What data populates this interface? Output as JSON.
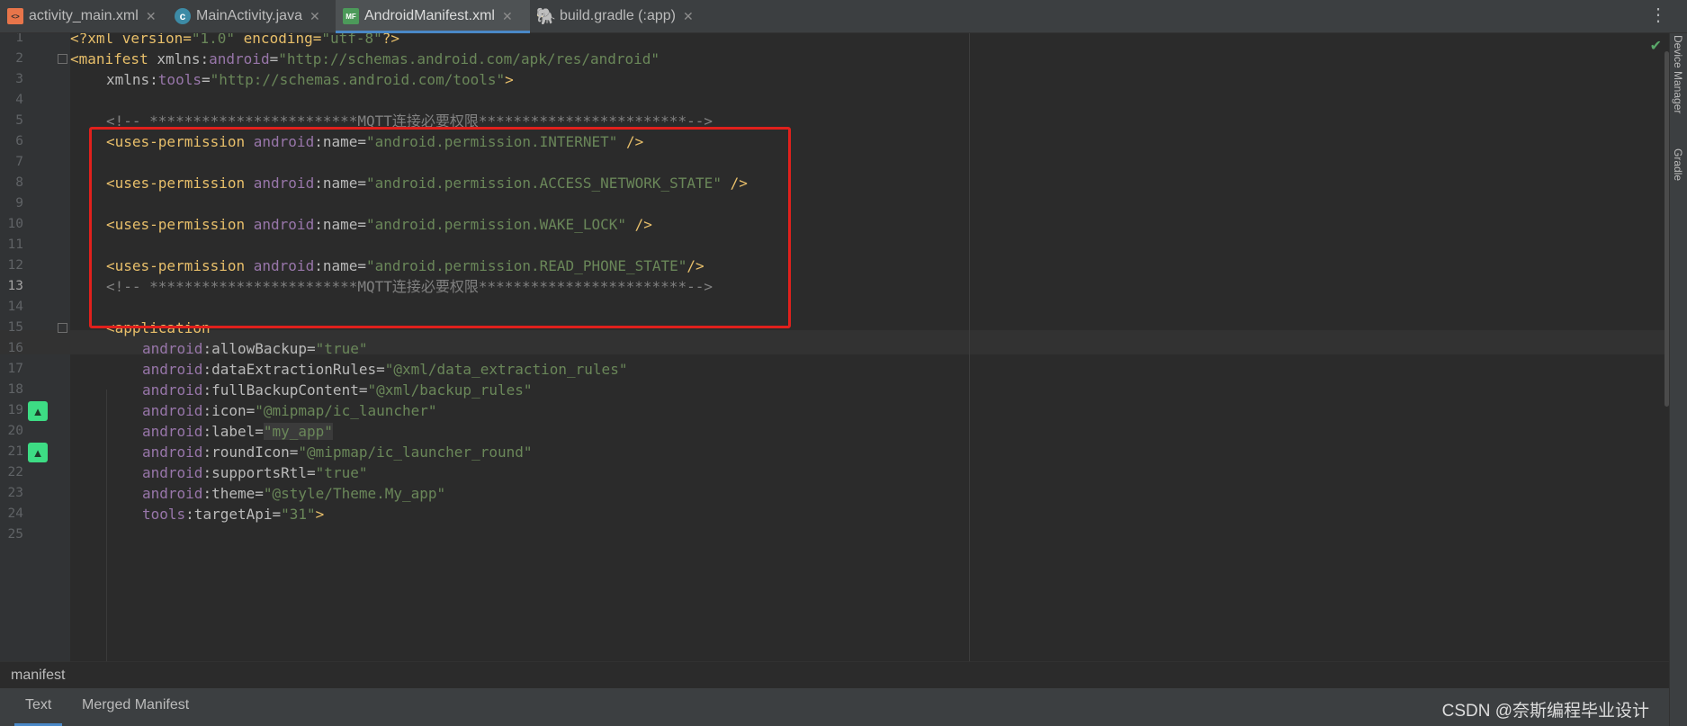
{
  "tabs": [
    {
      "label": "activity_main.xml",
      "icon": "xml-file-icon",
      "active": false
    },
    {
      "label": "MainActivity.java",
      "icon": "java-class-icon",
      "active": false
    },
    {
      "label": "AndroidManifest.xml",
      "icon": "manifest-file-icon",
      "active": true
    },
    {
      "label": "build.gradle (:app)",
      "icon": "gradle-icon",
      "active": false
    }
  ],
  "lines": {
    "l1": "1",
    "l2": "2",
    "l3": "3",
    "l4": "4",
    "l5": "5",
    "l6": "6",
    "l7": "7",
    "l8": "8",
    "l9": "9",
    "l10": "10",
    "l11": "11",
    "l12": "12",
    "l13": "13",
    "l14": "14",
    "l15": "15",
    "l16": "16",
    "l17": "17",
    "l18": "18",
    "l19": "19",
    "l20": "20",
    "l21": "21",
    "l22": "22",
    "l23": "23",
    "l24": "24",
    "l25": "25"
  },
  "code": {
    "l1": {
      "open": "<?xml version=",
      "ver": "\"1.0\"",
      "enc": " encoding=",
      "encv": "\"utf-8\"",
      "close": "?>"
    },
    "l2": {
      "tag": "<manifest",
      "attr": " xmlns:",
      "ns": "android",
      "eq": "=",
      "val": "\"http://schemas.android.com/apk/res/android\""
    },
    "l3": {
      "attr": "xmlns:",
      "ns": "tools",
      "eq": "=",
      "val": "\"http://schemas.android.com/tools\"",
      "close": ">"
    },
    "comment": "<!-- ************************MQTT连接必要权限************************-->",
    "perm_tag": "<uses-permission",
    "perm_ns": "android",
    "perm_attr": ":name=",
    "perm_close": " />",
    "perm_close_tight": "/>",
    "perms": [
      "\"android.permission.INTERNET\"",
      "\"android.permission.ACCESS_NETWORK_STATE\"",
      "\"android.permission.WAKE_LOCK\"",
      "\"android.permission.READ_PHONE_STATE\""
    ],
    "app_tag": "<application",
    "app_attrs": [
      {
        "ns": "android",
        "name": ":allowBackup=",
        "val": "\"true\""
      },
      {
        "ns": "android",
        "name": ":dataExtractionRules=",
        "val": "\"@xml/data_extraction_rules\""
      },
      {
        "ns": "android",
        "name": ":fullBackupContent=",
        "val": "\"@xml/backup_rules\""
      },
      {
        "ns": "android",
        "name": ":icon=",
        "val": "\"@mipmap/ic_launcher\""
      },
      {
        "ns": "android",
        "name": ":label=",
        "val": "\"my_app\""
      },
      {
        "ns": "android",
        "name": ":roundIcon=",
        "val": "\"@mipmap/ic_launcher_round\""
      },
      {
        "ns": "android",
        "name": ":supportsRtl=",
        "val": "\"true\""
      },
      {
        "ns": "android",
        "name": ":theme=",
        "val": "\"@style/Theme.My_app\""
      },
      {
        "ns": "tools",
        "name": ":targetApi=",
        "val": "\"31\"",
        "close": ">"
      }
    ]
  },
  "right_toolwindows": [
    "Device Manager",
    "Gradle"
  ],
  "breadcrumb": "manifest",
  "bottom_tabs": [
    "Text",
    "Merged Manifest"
  ],
  "watermark": "CSDN @奈斯编程毕业设计",
  "colors": {
    "highlight_box": "#e0201c",
    "tag": "#e8bf6a",
    "string": "#6a8759",
    "namespace": "#9876aa",
    "comment": "#808080"
  }
}
